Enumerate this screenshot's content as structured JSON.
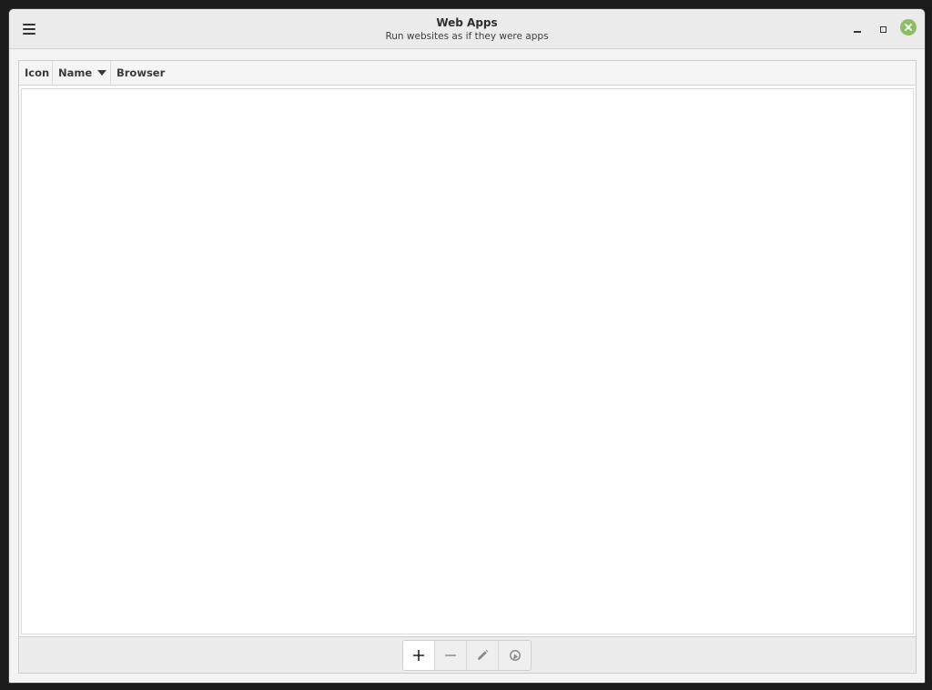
{
  "window": {
    "title": "Web Apps",
    "subtitle": "Run websites as if they were apps"
  },
  "table": {
    "columns": [
      {
        "label": "Icon"
      },
      {
        "label": "Name",
        "sorted": "descending"
      },
      {
        "label": "Browser"
      }
    ],
    "rows": []
  },
  "toolbar": {
    "buttons": [
      {
        "icon": "plus-icon"
      },
      {
        "icon": "minus-icon"
      },
      {
        "icon": "pencil-icon"
      },
      {
        "icon": "launch-icon"
      }
    ]
  },
  "colors": {
    "close_button": "#8cbf64",
    "window_bg": "#f3f3f3",
    "list_bg": "#ffffff"
  }
}
